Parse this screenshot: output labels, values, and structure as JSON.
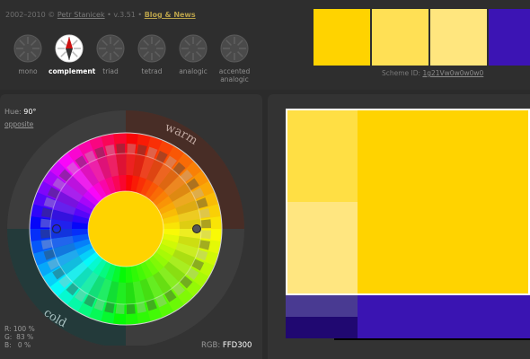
{
  "header": {
    "years": "2002–2010 ©",
    "author": "Petr Stanicek",
    "version": "• v.3.51 •",
    "blog": "Blog & News"
  },
  "modes": [
    {
      "label": "mono",
      "active": false
    },
    {
      "label": "complement",
      "active": true
    },
    {
      "label": "triad",
      "active": false
    },
    {
      "label": "tetrad",
      "active": false
    },
    {
      "label": "analogic",
      "active": false
    },
    {
      "label": "accented analogic",
      "active": false
    }
  ],
  "palette": {
    "swatches": [
      "#FFD300",
      "#FFE055",
      "#FFE67E",
      "#3C14B4"
    ],
    "scheme_id_label": "Scheme ID:",
    "scheme_id": "1g21Vw0w0w0w0"
  },
  "wheel": {
    "hue_label": "Hue:",
    "hue_value": "90°",
    "opposite_label": "opposite",
    "warm_label": "warm",
    "cold_label": "cold",
    "center_color": "#FFD300"
  },
  "rgb": {
    "r_line": "R: 100 %",
    "g_line": "G:  83 %",
    "b_line": "B:   0 %",
    "label": "RGB:",
    "hex": "FFD300"
  },
  "preview_colors": {
    "primary": "#FFD300",
    "primary_light": "#FFDF44",
    "primary_pale": "#FFE680",
    "complement": "#3A14B2",
    "complement_dark": "#200871",
    "complement_pale": "#493A92"
  }
}
